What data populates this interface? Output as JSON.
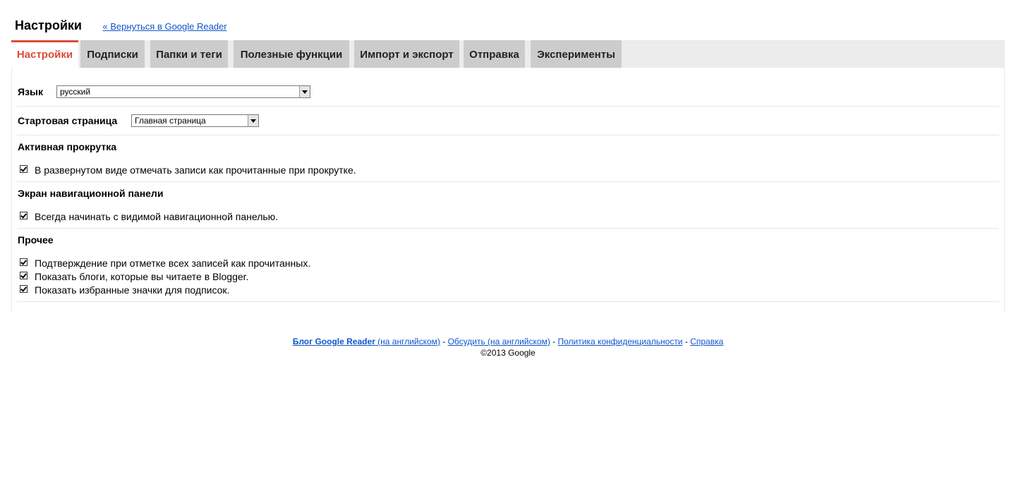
{
  "header": {
    "title": "Настройки",
    "back_link": "« Вернуться в Google Reader"
  },
  "tabs": [
    {
      "label": "Настройки",
      "active": true
    },
    {
      "label": "Подписки"
    },
    {
      "label": "Папки и теги"
    },
    {
      "label": "Полезные функции"
    },
    {
      "label": "Импорт и экспорт"
    },
    {
      "label": "Отправка"
    },
    {
      "label": "Эксперименты"
    }
  ],
  "settings": {
    "language": {
      "label": "Язык",
      "value": "русский"
    },
    "start_page": {
      "label": "Стартовая страница",
      "value": "Главная страница"
    },
    "scrolling": {
      "heading": "Активная прокрутка",
      "options": [
        {
          "label": "В развернутом виде отмечать записи как прочитанные при прокрутке.",
          "checked": true
        }
      ]
    },
    "navigation": {
      "heading": "Экран навигационной панели",
      "options": [
        {
          "label": "Всегда начинать с видимой навигационной панелью.",
          "checked": true
        }
      ]
    },
    "other": {
      "heading": "Прочее",
      "options": [
        {
          "label": "Подтверждение при отметке всех записей как прочитанных.",
          "checked": true
        },
        {
          "label": "Показать блоги, которые вы читаете в Blogger.",
          "checked": true
        },
        {
          "label": "Показать избранные значки для подписок.",
          "checked": true
        }
      ]
    }
  },
  "footer": {
    "blog_link": "Блог Google Reader",
    "blog_suffix": " (на английском)",
    "sep": " - ",
    "discuss_link": "Обсудить (на английском)",
    "privacy_link": "Политика конфиденциальности",
    "help_link": "Справка",
    "copyright": "©2013 Google"
  },
  "colors": {
    "accent": "#dd4b39",
    "link": "#1155cc",
    "tab_bg": "#cccccc",
    "tabbar_bg": "#ececec"
  }
}
